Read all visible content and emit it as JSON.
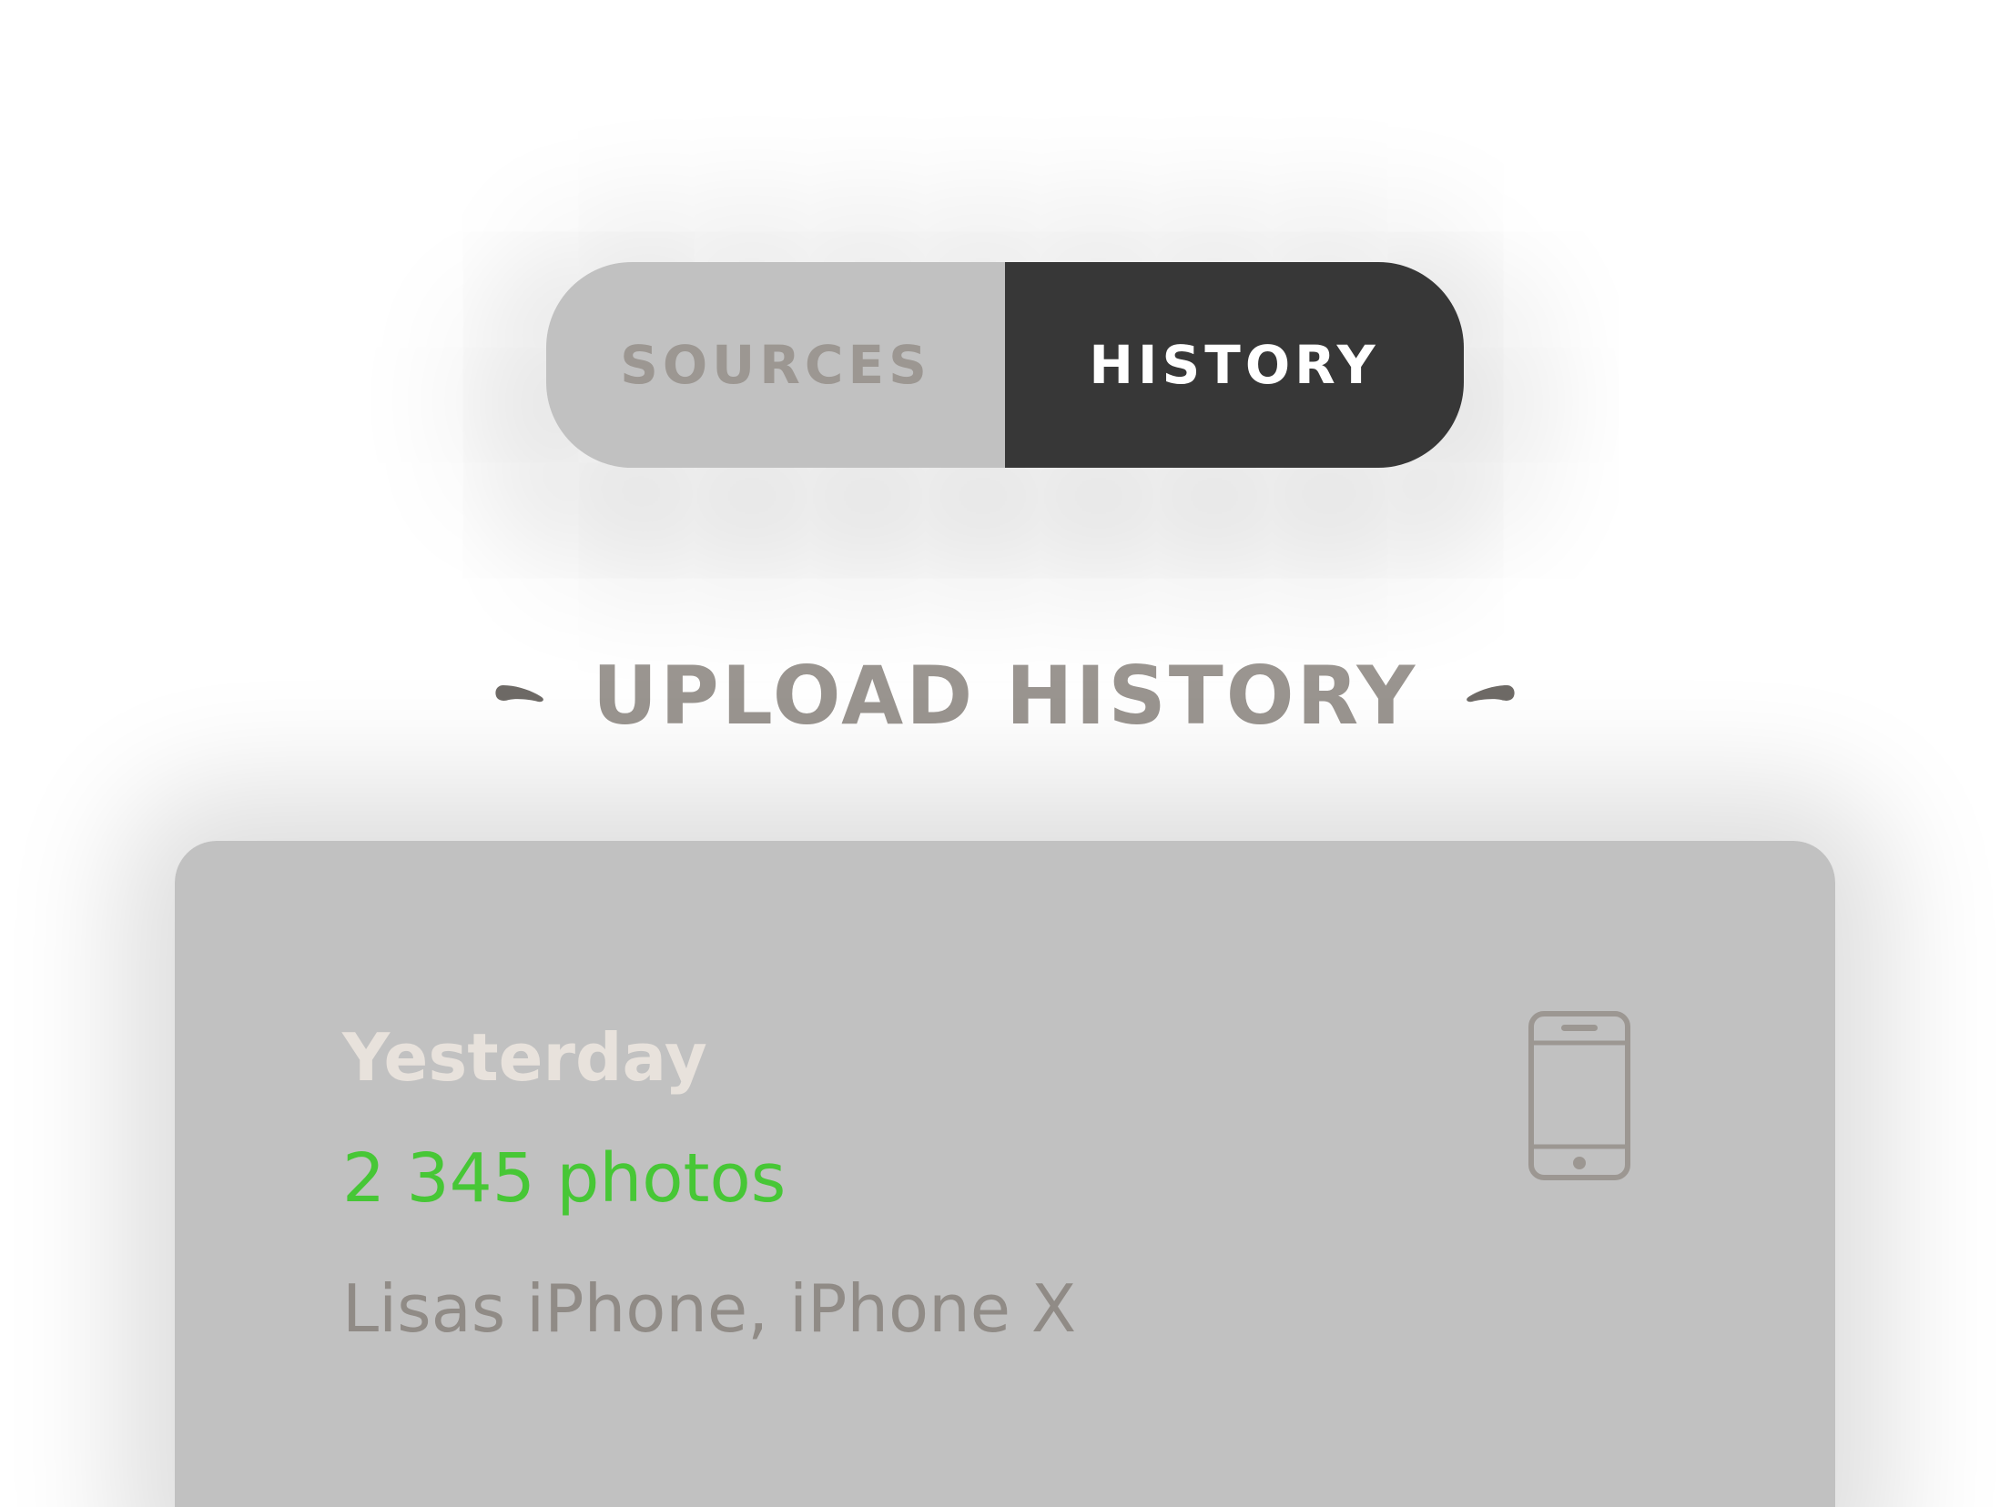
{
  "segmented_control": {
    "tabs": [
      {
        "label": "SOURCES",
        "active": false
      },
      {
        "label": "HISTORY",
        "active": true
      }
    ]
  },
  "section": {
    "title": "UPLOAD HISTORY"
  },
  "history_card": {
    "date": "Yesterday",
    "count": "2 345 photos",
    "device": "Lisas iPhone, iPhone X",
    "icon": "smartphone-icon"
  },
  "colors": {
    "card_background": "#c1c1c1",
    "active_tab": "#373737",
    "inactive_tab": "#c1c1c1",
    "count_text": "#47c736",
    "title_text": "#9a9590"
  }
}
